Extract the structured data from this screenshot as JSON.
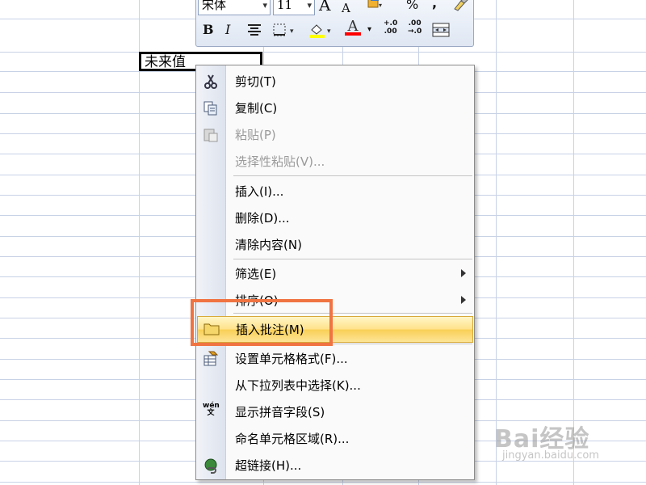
{
  "cell": {
    "value": "未来值"
  },
  "toolbar": {
    "font_name": "宋体",
    "font_size": "11",
    "grow_font_icon": "A",
    "shrink_font_icon": "A",
    "percent_label": "%",
    "comma_label": ",",
    "bold_label": "B",
    "italic_label": "I",
    "font_color_label": "A",
    "increase_decimal_label": "+.0\n.00",
    "decrease_decimal_label": ".00\n→.0"
  },
  "menu": {
    "items": [
      {
        "label": "剪切(T)",
        "icon": "scissors-icon",
        "enabled": true
      },
      {
        "label": "复制(C)",
        "icon": "copy-icon",
        "enabled": true
      },
      {
        "label": "粘贴(P)",
        "icon": "paste-icon",
        "enabled": false
      },
      {
        "label": "选择性粘贴(V)...",
        "icon": "",
        "enabled": false
      },
      {
        "label": "插入(I)...",
        "icon": "",
        "enabled": true
      },
      {
        "label": "删除(D)...",
        "icon": "",
        "enabled": true
      },
      {
        "label": "清除内容(N)",
        "icon": "",
        "enabled": true
      },
      {
        "label": "筛选(E)",
        "icon": "",
        "enabled": true,
        "submenu": true
      },
      {
        "label": "排序(O)",
        "icon": "",
        "enabled": true,
        "submenu": true
      },
      {
        "label": "插入批注(M)",
        "icon": "comment-icon",
        "enabled": true,
        "highlighted": true
      },
      {
        "label": "设置单元格格式(F)...",
        "icon": "format-cells-icon",
        "enabled": true
      },
      {
        "label": "从下拉列表中选择(K)...",
        "icon": "",
        "enabled": true
      },
      {
        "label": "显示拼音字段(S)",
        "icon": "phonetic-icon",
        "enabled": true
      },
      {
        "label": "命名单元格区域(R)...",
        "icon": "",
        "enabled": true
      },
      {
        "label": "超链接(H)...",
        "icon": "hyperlink-icon",
        "enabled": true
      }
    ]
  },
  "phonetic_icon_text": "wén\n文",
  "watermark": {
    "brand": "Bai经验",
    "url": "jingyan.baidu.com"
  },
  "colors": {
    "highlight_border": "#f07342",
    "hover_fill": "#ffe28a",
    "grid_line": "#c8d2e6",
    "fill_color_bar": "#ffff00",
    "font_color_bar": "#ff0000"
  }
}
